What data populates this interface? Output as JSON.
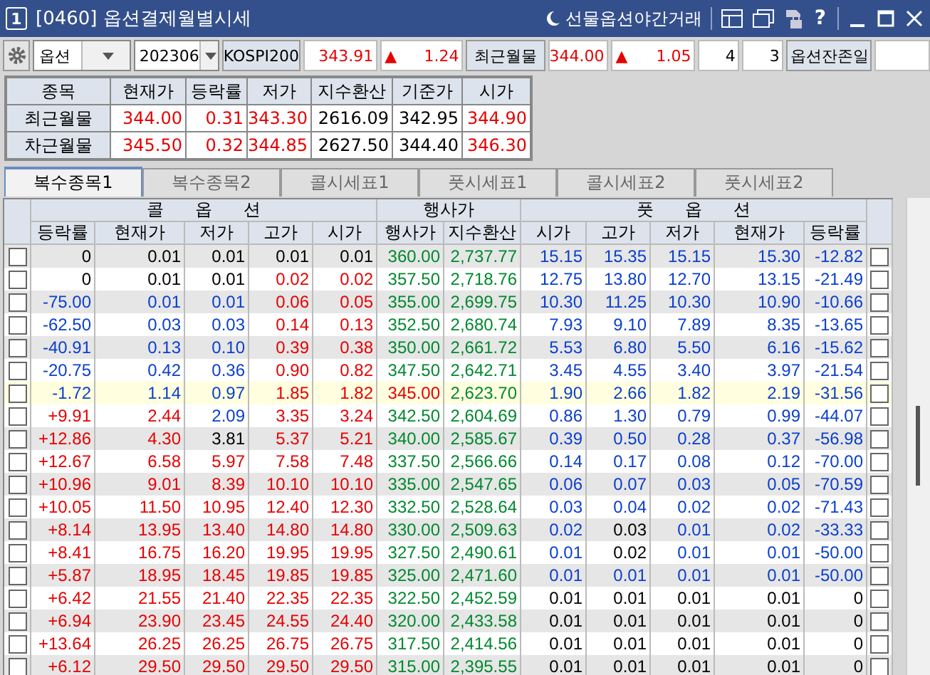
{
  "window": {
    "number": "1",
    "title": "[0460] 옵션결제월별시세",
    "night_trading": "선물옵션야간거래",
    "help": "?"
  },
  "toolbar": {
    "product": "옵션",
    "month": "202306",
    "index_label": "KOSPI200",
    "index_price": {
      "text": "343.91",
      "color": "#e60000"
    },
    "index_change": {
      "arrow": "▲",
      "text": "1.24",
      "color": "#e60000"
    },
    "front_label": "최근월물",
    "front_price": {
      "text": "344.00",
      "color": "#e60000"
    },
    "front_change": {
      "arrow": "▲",
      "text": "1.05",
      "color": "#e60000"
    },
    "count_1": "4",
    "count_2": "3",
    "remaining_label": "옵션잔존일"
  },
  "summary": {
    "columns": [
      "종목",
      "현재가",
      "등락률",
      "저가",
      "지수환산",
      "기준가",
      "시가"
    ],
    "rows": [
      {
        "cells": [
          {
            "text": "최근월물",
            "color": "#000000"
          },
          {
            "text": "344.00",
            "color": "#e60000"
          },
          {
            "text": "0.31",
            "color": "#e60000"
          },
          {
            "text": "343.30",
            "color": "#e60000"
          },
          {
            "text": "2616.09",
            "color": "#000000"
          },
          {
            "text": "342.95",
            "color": "#000000"
          },
          {
            "text": "344.90",
            "color": "#e60000"
          }
        ]
      },
      {
        "cells": [
          {
            "text": "차근월물",
            "color": "#000000"
          },
          {
            "text": "345.50",
            "color": "#e60000"
          },
          {
            "text": "0.32",
            "color": "#e60000"
          },
          {
            "text": "344.85",
            "color": "#e60000"
          },
          {
            "text": "2627.50",
            "color": "#000000"
          },
          {
            "text": "344.40",
            "color": "#000000"
          },
          {
            "text": "346.30",
            "color": "#e60000"
          }
        ]
      }
    ]
  },
  "tabs": [
    {
      "label": "복수종목1",
      "selected": true
    },
    {
      "label": "복수종목2",
      "selected": false
    },
    {
      "label": "콜시세표1",
      "selected": false
    },
    {
      "label": "풋시세표1",
      "selected": false
    },
    {
      "label": "콜시세표2",
      "selected": false
    },
    {
      "label": "풋시세표2",
      "selected": false
    }
  ],
  "grid": {
    "groups": [
      "콜 옵 션",
      "행사가",
      "풋 옵 션"
    ],
    "columns": [
      "등락률",
      "현재가",
      "저가",
      "고가",
      "시가",
      "행사가",
      "지수환산",
      "시가",
      "고가",
      "저가",
      "현재가",
      "등락률"
    ],
    "rows": [
      {
        "highlighted": false,
        "call_checked": false,
        "put_checked": false,
        "cells": [
          {
            "text": "0",
            "color": "#000000"
          },
          {
            "text": "0.01",
            "color": "#000000"
          },
          {
            "text": "0.01",
            "color": "#000000"
          },
          {
            "text": "0.01",
            "color": "#000000"
          },
          {
            "text": "0.01",
            "color": "#000000"
          },
          {
            "text": "360.00",
            "color": "#00892e"
          },
          {
            "text": "2,737.77",
            "color": "#00892e"
          },
          {
            "text": "15.15",
            "color": "#0a3fcc"
          },
          {
            "text": "15.35",
            "color": "#0a3fcc"
          },
          {
            "text": "15.15",
            "color": "#0a3fcc"
          },
          {
            "text": "15.30",
            "color": "#0a3fcc"
          },
          {
            "text": "-12.82",
            "color": "#0a3fcc"
          }
        ]
      },
      {
        "highlighted": false,
        "call_checked": false,
        "put_checked": false,
        "cells": [
          {
            "text": "0",
            "color": "#000000"
          },
          {
            "text": "0.01",
            "color": "#000000"
          },
          {
            "text": "0.01",
            "color": "#000000"
          },
          {
            "text": "0.02",
            "color": "#e60000"
          },
          {
            "text": "0.02",
            "color": "#e60000"
          },
          {
            "text": "357.50",
            "color": "#00892e"
          },
          {
            "text": "2,718.76",
            "color": "#00892e"
          },
          {
            "text": "12.75",
            "color": "#0a3fcc"
          },
          {
            "text": "13.80",
            "color": "#0a3fcc"
          },
          {
            "text": "12.70",
            "color": "#0a3fcc"
          },
          {
            "text": "13.15",
            "color": "#0a3fcc"
          },
          {
            "text": "-21.49",
            "color": "#0a3fcc"
          }
        ]
      },
      {
        "highlighted": false,
        "call_checked": false,
        "put_checked": false,
        "cells": [
          {
            "text": "-75.00",
            "color": "#0a3fcc"
          },
          {
            "text": "0.01",
            "color": "#0a3fcc"
          },
          {
            "text": "0.01",
            "color": "#0a3fcc"
          },
          {
            "text": "0.06",
            "color": "#e60000"
          },
          {
            "text": "0.05",
            "color": "#e60000"
          },
          {
            "text": "355.00",
            "color": "#00892e"
          },
          {
            "text": "2,699.75",
            "color": "#00892e"
          },
          {
            "text": "10.30",
            "color": "#0a3fcc"
          },
          {
            "text": "11.25",
            "color": "#0a3fcc"
          },
          {
            "text": "10.30",
            "color": "#0a3fcc"
          },
          {
            "text": "10.90",
            "color": "#0a3fcc"
          },
          {
            "text": "-10.66",
            "color": "#0a3fcc"
          }
        ]
      },
      {
        "highlighted": false,
        "call_checked": false,
        "put_checked": false,
        "cells": [
          {
            "text": "-62.50",
            "color": "#0a3fcc"
          },
          {
            "text": "0.03",
            "color": "#0a3fcc"
          },
          {
            "text": "0.03",
            "color": "#0a3fcc"
          },
          {
            "text": "0.14",
            "color": "#e60000"
          },
          {
            "text": "0.13",
            "color": "#e60000"
          },
          {
            "text": "352.50",
            "color": "#00892e"
          },
          {
            "text": "2,680.74",
            "color": "#00892e"
          },
          {
            "text": "7.93",
            "color": "#0a3fcc"
          },
          {
            "text": "9.10",
            "color": "#0a3fcc"
          },
          {
            "text": "7.89",
            "color": "#0a3fcc"
          },
          {
            "text": "8.35",
            "color": "#0a3fcc"
          },
          {
            "text": "-13.65",
            "color": "#0a3fcc"
          }
        ]
      },
      {
        "highlighted": false,
        "call_checked": false,
        "put_checked": false,
        "cells": [
          {
            "text": "-40.91",
            "color": "#0a3fcc"
          },
          {
            "text": "0.13",
            "color": "#0a3fcc"
          },
          {
            "text": "0.10",
            "color": "#0a3fcc"
          },
          {
            "text": "0.39",
            "color": "#e60000"
          },
          {
            "text": "0.38",
            "color": "#e60000"
          },
          {
            "text": "350.00",
            "color": "#00892e"
          },
          {
            "text": "2,661.72",
            "color": "#00892e"
          },
          {
            "text": "5.53",
            "color": "#0a3fcc"
          },
          {
            "text": "6.80",
            "color": "#0a3fcc"
          },
          {
            "text": "5.50",
            "color": "#0a3fcc"
          },
          {
            "text": "6.16",
            "color": "#0a3fcc"
          },
          {
            "text": "-15.62",
            "color": "#0a3fcc"
          }
        ]
      },
      {
        "highlighted": false,
        "call_checked": false,
        "put_checked": false,
        "cells": [
          {
            "text": "-20.75",
            "color": "#0a3fcc"
          },
          {
            "text": "0.42",
            "color": "#0a3fcc"
          },
          {
            "text": "0.36",
            "color": "#0a3fcc"
          },
          {
            "text": "0.90",
            "color": "#e60000"
          },
          {
            "text": "0.82",
            "color": "#e60000"
          },
          {
            "text": "347.50",
            "color": "#00892e"
          },
          {
            "text": "2,642.71",
            "color": "#00892e"
          },
          {
            "text": "3.45",
            "color": "#0a3fcc"
          },
          {
            "text": "4.55",
            "color": "#0a3fcc"
          },
          {
            "text": "3.40",
            "color": "#0a3fcc"
          },
          {
            "text": "3.97",
            "color": "#0a3fcc"
          },
          {
            "text": "-21.54",
            "color": "#0a3fcc"
          }
        ]
      },
      {
        "highlighted": true,
        "call_checked": false,
        "put_checked": false,
        "cells": [
          {
            "text": "-1.72",
            "color": "#0a3fcc"
          },
          {
            "text": "1.14",
            "color": "#0a3fcc"
          },
          {
            "text": "0.97",
            "color": "#0a3fcc"
          },
          {
            "text": "1.85",
            "color": "#e60000"
          },
          {
            "text": "1.82",
            "color": "#e60000"
          },
          {
            "text": "345.00",
            "color": "#e60000"
          },
          {
            "text": "2,623.70",
            "color": "#00892e"
          },
          {
            "text": "1.90",
            "color": "#0a3fcc"
          },
          {
            "text": "2.66",
            "color": "#0a3fcc"
          },
          {
            "text": "1.82",
            "color": "#0a3fcc"
          },
          {
            "text": "2.19",
            "color": "#0a3fcc"
          },
          {
            "text": "-31.56",
            "color": "#0a3fcc"
          }
        ]
      },
      {
        "highlighted": false,
        "call_checked": false,
        "put_checked": false,
        "cells": [
          {
            "text": "+9.91",
            "color": "#e60000"
          },
          {
            "text": "2.44",
            "color": "#e60000"
          },
          {
            "text": "2.09",
            "color": "#0a3fcc"
          },
          {
            "text": "3.35",
            "color": "#e60000"
          },
          {
            "text": "3.24",
            "color": "#e60000"
          },
          {
            "text": "342.50",
            "color": "#00892e"
          },
          {
            "text": "2,604.69",
            "color": "#00892e"
          },
          {
            "text": "0.86",
            "color": "#0a3fcc"
          },
          {
            "text": "1.30",
            "color": "#0a3fcc"
          },
          {
            "text": "0.79",
            "color": "#0a3fcc"
          },
          {
            "text": "0.99",
            "color": "#0a3fcc"
          },
          {
            "text": "-44.07",
            "color": "#0a3fcc"
          }
        ]
      },
      {
        "highlighted": false,
        "call_checked": false,
        "put_checked": false,
        "cells": [
          {
            "text": "+12.86",
            "color": "#e60000"
          },
          {
            "text": "4.30",
            "color": "#e60000"
          },
          {
            "text": "3.81",
            "color": "#000000"
          },
          {
            "text": "5.37",
            "color": "#e60000"
          },
          {
            "text": "5.21",
            "color": "#e60000"
          },
          {
            "text": "340.00",
            "color": "#00892e"
          },
          {
            "text": "2,585.67",
            "color": "#00892e"
          },
          {
            "text": "0.39",
            "color": "#0a3fcc"
          },
          {
            "text": "0.50",
            "color": "#0a3fcc"
          },
          {
            "text": "0.28",
            "color": "#0a3fcc"
          },
          {
            "text": "0.37",
            "color": "#0a3fcc"
          },
          {
            "text": "-56.98",
            "color": "#0a3fcc"
          }
        ]
      },
      {
        "highlighted": false,
        "call_checked": false,
        "put_checked": false,
        "cells": [
          {
            "text": "+12.67",
            "color": "#e60000"
          },
          {
            "text": "6.58",
            "color": "#e60000"
          },
          {
            "text": "5.97",
            "color": "#e60000"
          },
          {
            "text": "7.58",
            "color": "#e60000"
          },
          {
            "text": "7.48",
            "color": "#e60000"
          },
          {
            "text": "337.50",
            "color": "#00892e"
          },
          {
            "text": "2,566.66",
            "color": "#00892e"
          },
          {
            "text": "0.14",
            "color": "#0a3fcc"
          },
          {
            "text": "0.17",
            "color": "#0a3fcc"
          },
          {
            "text": "0.08",
            "color": "#0a3fcc"
          },
          {
            "text": "0.12",
            "color": "#0a3fcc"
          },
          {
            "text": "-70.00",
            "color": "#0a3fcc"
          }
        ]
      },
      {
        "highlighted": false,
        "call_checked": false,
        "put_checked": false,
        "cells": [
          {
            "text": "+10.96",
            "color": "#e60000"
          },
          {
            "text": "9.01",
            "color": "#e60000"
          },
          {
            "text": "8.39",
            "color": "#e60000"
          },
          {
            "text": "10.10",
            "color": "#e60000"
          },
          {
            "text": "10.10",
            "color": "#e60000"
          },
          {
            "text": "335.00",
            "color": "#00892e"
          },
          {
            "text": "2,547.65",
            "color": "#00892e"
          },
          {
            "text": "0.06",
            "color": "#0a3fcc"
          },
          {
            "text": "0.07",
            "color": "#0a3fcc"
          },
          {
            "text": "0.03",
            "color": "#0a3fcc"
          },
          {
            "text": "0.05",
            "color": "#0a3fcc"
          },
          {
            "text": "-70.59",
            "color": "#0a3fcc"
          }
        ]
      },
      {
        "highlighted": false,
        "call_checked": false,
        "put_checked": false,
        "cells": [
          {
            "text": "+10.05",
            "color": "#e60000"
          },
          {
            "text": "11.50",
            "color": "#e60000"
          },
          {
            "text": "10.95",
            "color": "#e60000"
          },
          {
            "text": "12.40",
            "color": "#e60000"
          },
          {
            "text": "12.30",
            "color": "#e60000"
          },
          {
            "text": "332.50",
            "color": "#00892e"
          },
          {
            "text": "2,528.64",
            "color": "#00892e"
          },
          {
            "text": "0.03",
            "color": "#0a3fcc"
          },
          {
            "text": "0.04",
            "color": "#0a3fcc"
          },
          {
            "text": "0.02",
            "color": "#0a3fcc"
          },
          {
            "text": "0.02",
            "color": "#0a3fcc"
          },
          {
            "text": "-71.43",
            "color": "#0a3fcc"
          }
        ]
      },
      {
        "highlighted": false,
        "call_checked": false,
        "put_checked": false,
        "cells": [
          {
            "text": "+8.14",
            "color": "#e60000"
          },
          {
            "text": "13.95",
            "color": "#e60000"
          },
          {
            "text": "13.40",
            "color": "#e60000"
          },
          {
            "text": "14.80",
            "color": "#e60000"
          },
          {
            "text": "14.80",
            "color": "#e60000"
          },
          {
            "text": "330.00",
            "color": "#00892e"
          },
          {
            "text": "2,509.63",
            "color": "#00892e"
          },
          {
            "text": "0.02",
            "color": "#0a3fcc"
          },
          {
            "text": "0.03",
            "color": "#000000"
          },
          {
            "text": "0.01",
            "color": "#0a3fcc"
          },
          {
            "text": "0.02",
            "color": "#0a3fcc"
          },
          {
            "text": "-33.33",
            "color": "#0a3fcc"
          }
        ]
      },
      {
        "highlighted": false,
        "call_checked": false,
        "put_checked": false,
        "cells": [
          {
            "text": "+8.41",
            "color": "#e60000"
          },
          {
            "text": "16.75",
            "color": "#e60000"
          },
          {
            "text": "16.20",
            "color": "#e60000"
          },
          {
            "text": "19.95",
            "color": "#e60000"
          },
          {
            "text": "19.95",
            "color": "#e60000"
          },
          {
            "text": "327.50",
            "color": "#00892e"
          },
          {
            "text": "2,490.61",
            "color": "#00892e"
          },
          {
            "text": "0.01",
            "color": "#0a3fcc"
          },
          {
            "text": "0.02",
            "color": "#000000"
          },
          {
            "text": "0.01",
            "color": "#0a3fcc"
          },
          {
            "text": "0.01",
            "color": "#0a3fcc"
          },
          {
            "text": "-50.00",
            "color": "#0a3fcc"
          }
        ]
      },
      {
        "highlighted": false,
        "call_checked": false,
        "put_checked": false,
        "cells": [
          {
            "text": "+5.87",
            "color": "#e60000"
          },
          {
            "text": "18.95",
            "color": "#e60000"
          },
          {
            "text": "18.45",
            "color": "#e60000"
          },
          {
            "text": "19.85",
            "color": "#e60000"
          },
          {
            "text": "19.85",
            "color": "#e60000"
          },
          {
            "text": "325.00",
            "color": "#00892e"
          },
          {
            "text": "2,471.60",
            "color": "#00892e"
          },
          {
            "text": "0.01",
            "color": "#0a3fcc"
          },
          {
            "text": "0.01",
            "color": "#0a3fcc"
          },
          {
            "text": "0.01",
            "color": "#0a3fcc"
          },
          {
            "text": "0.01",
            "color": "#0a3fcc"
          },
          {
            "text": "-50.00",
            "color": "#0a3fcc"
          }
        ]
      },
      {
        "highlighted": false,
        "call_checked": false,
        "put_checked": false,
        "cells": [
          {
            "text": "+6.42",
            "color": "#e60000"
          },
          {
            "text": "21.55",
            "color": "#e60000"
          },
          {
            "text": "21.40",
            "color": "#e60000"
          },
          {
            "text": "22.35",
            "color": "#e60000"
          },
          {
            "text": "22.35",
            "color": "#e60000"
          },
          {
            "text": "322.50",
            "color": "#00892e"
          },
          {
            "text": "2,452.59",
            "color": "#00892e"
          },
          {
            "text": "0.01",
            "color": "#000000"
          },
          {
            "text": "0.01",
            "color": "#000000"
          },
          {
            "text": "0.01",
            "color": "#000000"
          },
          {
            "text": "0.01",
            "color": "#000000"
          },
          {
            "text": "0",
            "color": "#000000"
          }
        ]
      },
      {
        "highlighted": false,
        "call_checked": false,
        "put_checked": false,
        "cells": [
          {
            "text": "+6.94",
            "color": "#e60000"
          },
          {
            "text": "23.90",
            "color": "#e60000"
          },
          {
            "text": "23.45",
            "color": "#e60000"
          },
          {
            "text": "24.55",
            "color": "#e60000"
          },
          {
            "text": "24.40",
            "color": "#e60000"
          },
          {
            "text": "320.00",
            "color": "#00892e"
          },
          {
            "text": "2,433.58",
            "color": "#00892e"
          },
          {
            "text": "0.01",
            "color": "#000000"
          },
          {
            "text": "0.01",
            "color": "#000000"
          },
          {
            "text": "0.01",
            "color": "#000000"
          },
          {
            "text": "0.01",
            "color": "#000000"
          },
          {
            "text": "0",
            "color": "#000000"
          }
        ]
      },
      {
        "highlighted": false,
        "call_checked": false,
        "put_checked": false,
        "cells": [
          {
            "text": "+13.64",
            "color": "#e60000"
          },
          {
            "text": "26.25",
            "color": "#e60000"
          },
          {
            "text": "26.25",
            "color": "#e60000"
          },
          {
            "text": "26.75",
            "color": "#e60000"
          },
          {
            "text": "26.75",
            "color": "#e60000"
          },
          {
            "text": "317.50",
            "color": "#00892e"
          },
          {
            "text": "2,414.56",
            "color": "#00892e"
          },
          {
            "text": "0.01",
            "color": "#000000"
          },
          {
            "text": "0.01",
            "color": "#000000"
          },
          {
            "text": "0.01",
            "color": "#000000"
          },
          {
            "text": "0.01",
            "color": "#000000"
          },
          {
            "text": "0",
            "color": "#000000"
          }
        ]
      },
      {
        "highlighted": false,
        "call_checked": false,
        "put_checked": false,
        "cells": [
          {
            "text": "+6.12",
            "color": "#e60000"
          },
          {
            "text": "29.50",
            "color": "#e60000"
          },
          {
            "text": "29.50",
            "color": "#e60000"
          },
          {
            "text": "29.50",
            "color": "#e60000"
          },
          {
            "text": "29.50",
            "color": "#e60000"
          },
          {
            "text": "315.00",
            "color": "#00892e"
          },
          {
            "text": "2,395.55",
            "color": "#00892e"
          },
          {
            "text": "0.01",
            "color": "#000000"
          },
          {
            "text": "0.01",
            "color": "#000000"
          },
          {
            "text": "0.01",
            "color": "#000000"
          },
          {
            "text": "0.01",
            "color": "#000000"
          },
          {
            "text": "0",
            "color": "#000000"
          }
        ]
      }
    ]
  }
}
